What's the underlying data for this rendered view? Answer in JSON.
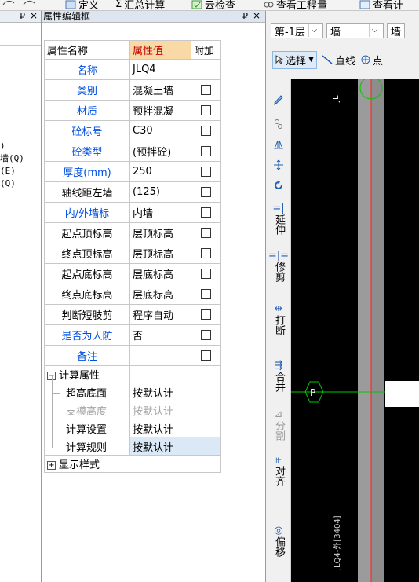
{
  "toolbar": {
    "items": [
      "定义",
      "汇总计算",
      "云检查",
      "查看工程量",
      "查看计"
    ],
    "sum_symbol": "Σ"
  },
  "left_panel": {
    "pin": "₽",
    "close": "×",
    "lines": [
      ")",
      "墙(Q)",
      "(E)",
      "(Q)"
    ]
  },
  "property_panel": {
    "title": "属性编辑框",
    "pin": "₽",
    "close": "×",
    "headers": [
      "属性名称",
      "属性值",
      "附加"
    ],
    "rows": [
      {
        "name": "名称",
        "value": "JLQ4",
        "blue": true,
        "check": false
      },
      {
        "name": "类别",
        "value": "混凝土墙",
        "blue": true,
        "check": true
      },
      {
        "name": "材质",
        "value": "预拌混凝",
        "blue": true,
        "check": true
      },
      {
        "name": "砼标号",
        "value": "C30",
        "blue": true,
        "check": true
      },
      {
        "name": "砼类型",
        "value": "(预拌砼)",
        "blue": true,
        "check": true
      },
      {
        "name": "厚度(mm)",
        "value": "250",
        "blue": true,
        "check": true
      },
      {
        "name": "轴线距左墙",
        "value": "(125)",
        "blue": false,
        "check": true
      },
      {
        "name": "内/外墙标",
        "value": "内墙",
        "blue": true,
        "check": true
      },
      {
        "name": "起点顶标高",
        "value": "层顶标高",
        "blue": false,
        "check": true
      },
      {
        "name": "终点顶标高",
        "value": "层顶标高",
        "blue": false,
        "check": true
      },
      {
        "name": "起点底标高",
        "value": "层底标高",
        "blue": false,
        "check": true
      },
      {
        "name": "终点底标高",
        "value": "层底标高",
        "blue": false,
        "check": true
      },
      {
        "name": "判断短肢剪",
        "value": "程序自动",
        "blue": false,
        "check": true
      },
      {
        "name": "是否为人防",
        "value": "否",
        "blue": true,
        "check": true
      },
      {
        "name": "备注",
        "value": "",
        "blue": true,
        "check": true
      }
    ],
    "calc_group": {
      "expander": "−",
      "label": "计算属性",
      "items": [
        {
          "name": "超高底面",
          "value": "按默认计",
          "grey": false,
          "selected": false
        },
        {
          "name": "支模高度",
          "value": "按默认计",
          "grey": true,
          "selected": false
        },
        {
          "name": "计算设置",
          "value": "按默认计",
          "grey": false,
          "selected": false
        },
        {
          "name": "计算规则",
          "value": "按默认计",
          "grey": false,
          "selected": true
        }
      ]
    },
    "style_group": {
      "expander": "+",
      "label": "显示样式"
    }
  },
  "floor_selector": {
    "floor": "第-1层",
    "type": "墙",
    "type2": "墙"
  },
  "draw_toolbar": {
    "select": "选择",
    "line": "直线",
    "point": "点"
  },
  "vertical_tools": {
    "extend": "延伸",
    "trim": "修剪",
    "break": "打断",
    "merge": "合并",
    "split": "分割",
    "align": "对齐",
    "offset": "偏移"
  },
  "canvas": {
    "axis_label": "P",
    "wall_label": "JLQ4-外[3404]",
    "top_label": "JL"
  },
  "colors": {
    "canvas_bg": "#000000",
    "axis_green": "#00c800",
    "axis_red": "#ff2020",
    "wall_grey": "#9b9b9b",
    "header_highlight": "#f9d9a6"
  }
}
